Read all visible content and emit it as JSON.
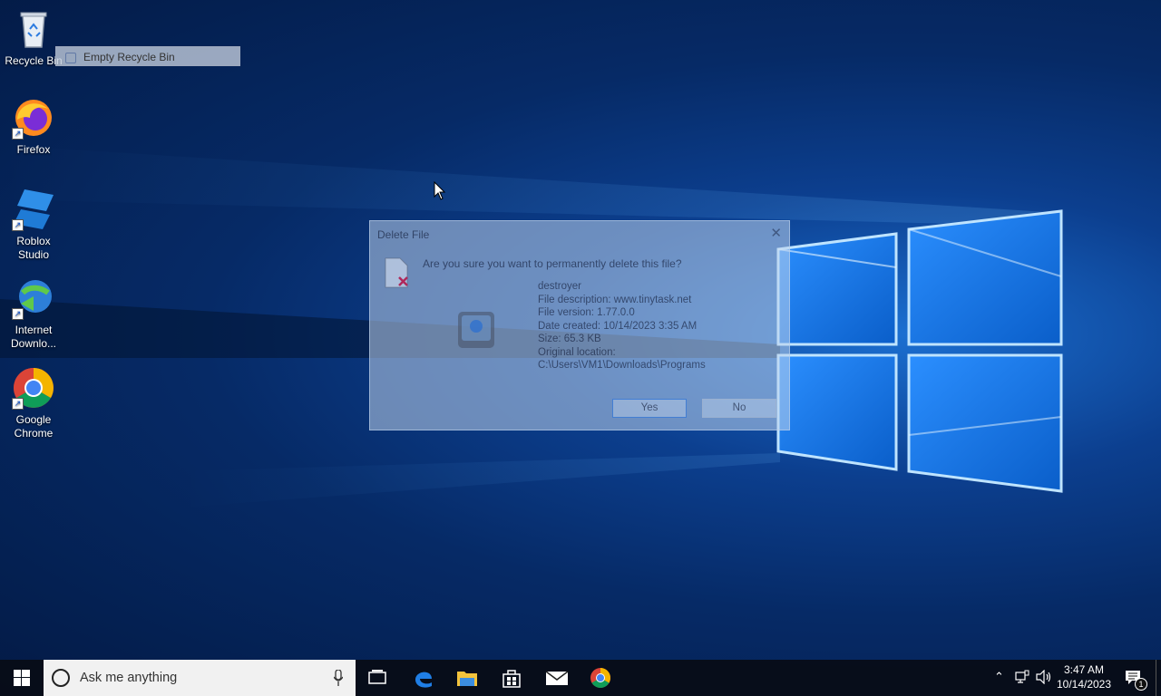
{
  "desktop": {
    "icons": [
      {
        "label": "Recycle Bin",
        "icon": "recycle-bin-icon"
      },
      {
        "label": "Firefox",
        "icon": "firefox-icon"
      },
      {
        "label": "Roblox Studio",
        "line1": "Roblox",
        "line2": "Studio",
        "icon": "roblox-studio-icon"
      },
      {
        "label": "Internet Downlo...",
        "line1": "Internet",
        "line2": "Downlo...",
        "icon": "internet-download-manager-icon"
      },
      {
        "label": "Google Chrome",
        "line1": "Google",
        "line2": "Chrome",
        "icon": "chrome-icon"
      }
    ],
    "context_item": "Empty Recycle Bin"
  },
  "dialog": {
    "title": "Delete File",
    "close_label": "✕",
    "question": "Are you sure you want to permanently delete this file?",
    "file_name": "destroyer",
    "file_description": "File description: www.tinytask.net",
    "file_version": "File version: 1.77.0.0",
    "date_created": "Date created: 10/14/2023 3:35 AM",
    "size": "Size: 65.3 KB",
    "original_location_label": "Original location:",
    "original_location": "C:\\Users\\VM1\\Downloads\\Programs",
    "yes_label": "Yes",
    "no_label": "No"
  },
  "taskbar": {
    "search_placeholder": "Ask me anything",
    "pinned": [
      "task-view-icon",
      "edge-icon",
      "file-explorer-icon",
      "store-icon",
      "mail-icon",
      "chrome-icon"
    ],
    "time": "3:47 AM",
    "date": "10/14/2023",
    "notification_count": "1"
  },
  "colors": {
    "wallpaper_dark": "#031a45",
    "wallpaper_light": "#1b6fd1",
    "taskbar": "#080c16",
    "accent": "#0078d7"
  }
}
